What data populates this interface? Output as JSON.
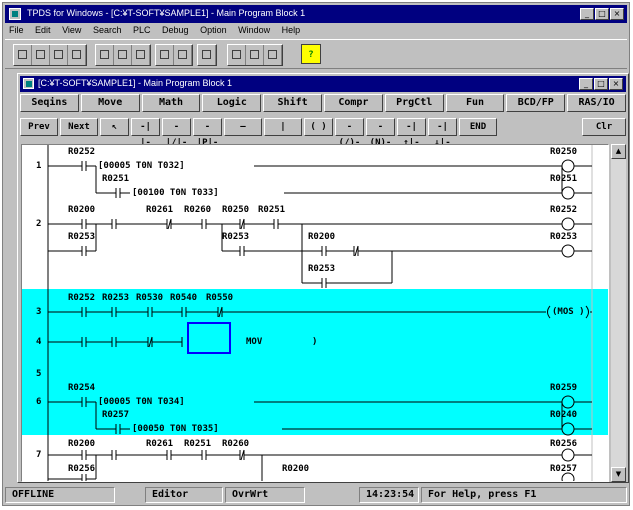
{
  "app": {
    "title": "TPDS for Windows - [C:¥T-SOFT¥SAMPLE1] - Main Program Block 1",
    "window_buttons": [
      "_",
      "□",
      "×"
    ],
    "menu": [
      "File",
      "Edit",
      "View",
      "Search",
      "PLC",
      "Debug",
      "Option",
      "Window",
      "Help"
    ],
    "help_button": "?"
  },
  "child": {
    "title": "[C:¥T-SOFT¥SAMPLE1] - Main Program Block 1",
    "window_buttons": [
      "_",
      "□",
      "×"
    ],
    "function_keys": [
      "Seqins",
      "Move",
      "Math",
      "Logic",
      "Shift",
      "Compr",
      "PrgCtl",
      "Fun",
      "BCD/FP",
      "RAS/IO"
    ],
    "instruction_keys": [
      "Prev",
      "Next",
      "↖",
      "-| |-",
      "-|/|-",
      "-|P|-",
      "—",
      "|",
      "( )",
      "-(/)-",
      "-(N)-",
      "-|↑|-",
      "-|↓|-",
      "END",
      "Clr"
    ]
  },
  "ladder": {
    "rung_numbers": [
      "1",
      "2",
      "3",
      "4",
      "5",
      "6",
      "7"
    ],
    "contacts": [
      "R0252",
      "R0250",
      "R0251",
      "R0200",
      "R0261",
      "R0260",
      "R0250",
      "R0251",
      "R0252",
      "R0252",
      "R0253",
      "R0200",
      "R0253",
      "R0253",
      "R0252",
      "R0253",
      "R0530",
      "R0540",
      "R0550",
      "R0254",
      "R0259",
      "R0257",
      "R0240",
      "R0200",
      "R0261",
      "R0251",
      "R0260",
      "R0256",
      "R0256",
      "R0200",
      "R0257"
    ],
    "timer_lines": [
      "[00005  T0N  T032]",
      "[00100  T0N  T033]",
      "[00005  T0N  T034]",
      "[00050  T0N  T035]"
    ],
    "coil_label": "(MOS )",
    "edit_text": "MOV",
    "edit_close": ")"
  },
  "status": {
    "mode": "OFFLINE",
    "editor": "Editor",
    "overwrite": "OvrWrt",
    "time": "14:23:54",
    "help": "For Help, press F1"
  },
  "colors": {
    "title": "#000080",
    "highlight": "#00ffff",
    "face": "#c0c0c0",
    "cursor": "#0000ff"
  }
}
